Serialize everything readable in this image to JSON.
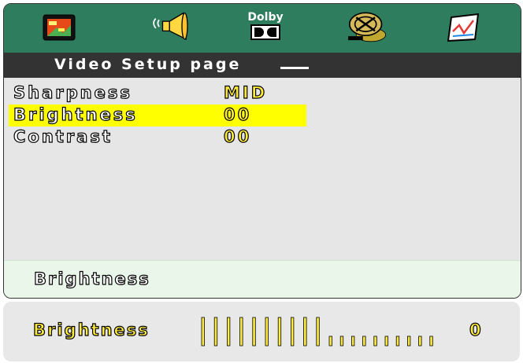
{
  "tabs": [
    {
      "name": "general-setup"
    },
    {
      "name": "audio-setup"
    },
    {
      "name": "dolby-setup",
      "label": "Dolby"
    },
    {
      "name": "video-setup"
    },
    {
      "name": "preference-setup"
    }
  ],
  "header": {
    "title": "Video Setup page"
  },
  "menu": {
    "items": [
      {
        "label": "Sharpness",
        "value": "MID"
      },
      {
        "label": "Brightness",
        "value": "00"
      },
      {
        "label": "Contrast",
        "value": "00"
      }
    ],
    "selected_index": 1
  },
  "status": {
    "text": "Brightness"
  },
  "adjust": {
    "label": "Brightness",
    "value": "0",
    "level_fraction": 0.5
  },
  "colors": {
    "tabbar": "#2e7d5e",
    "titlebar": "#333333",
    "highlight": "#ffff00",
    "value_text": "#ffeb3b"
  }
}
